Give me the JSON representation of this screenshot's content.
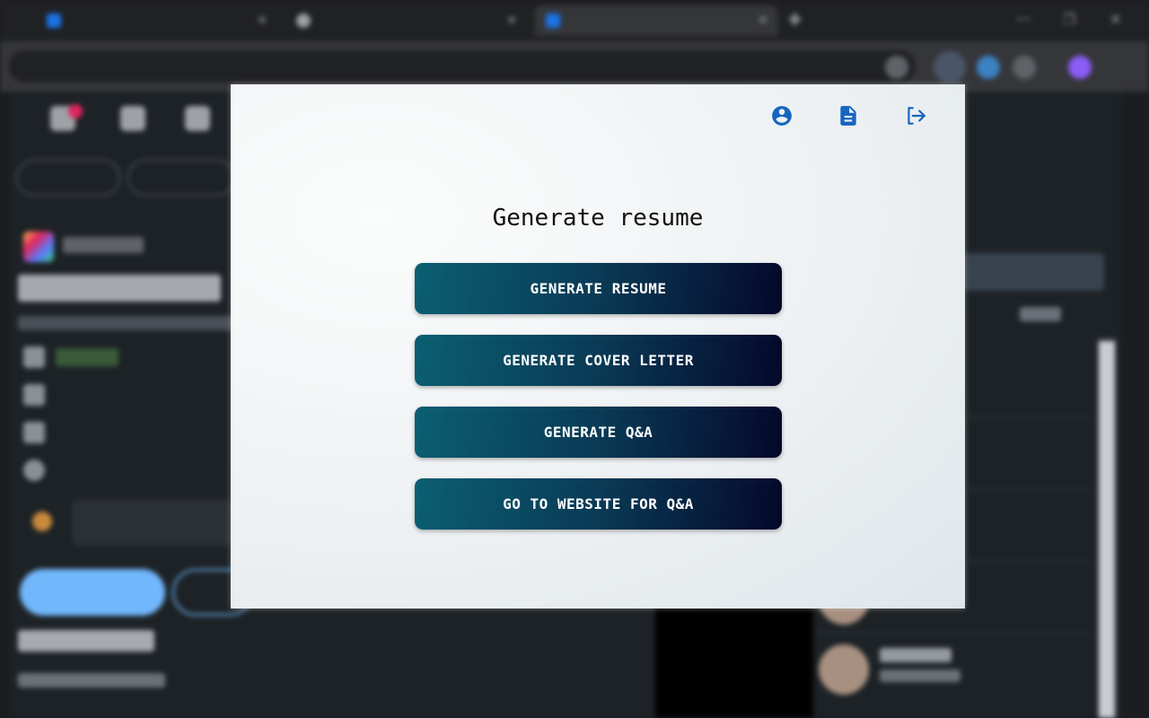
{
  "popup": {
    "heading": "Generate resume",
    "icons": [
      "account-circle-icon",
      "document-icon",
      "logout-icon"
    ],
    "buttons": [
      {
        "label": "GENERATE RESUME"
      },
      {
        "label": "GENERATE COVER LETTER"
      },
      {
        "label": "GENERATE Q&A"
      },
      {
        "label": "GO TO WEBSITE FOR Q&A"
      }
    ],
    "colors": {
      "icon": "#1565c0",
      "button_start": "#0b5f72",
      "button_end": "#04082a",
      "popup_bg": "#eef1f3"
    }
  }
}
